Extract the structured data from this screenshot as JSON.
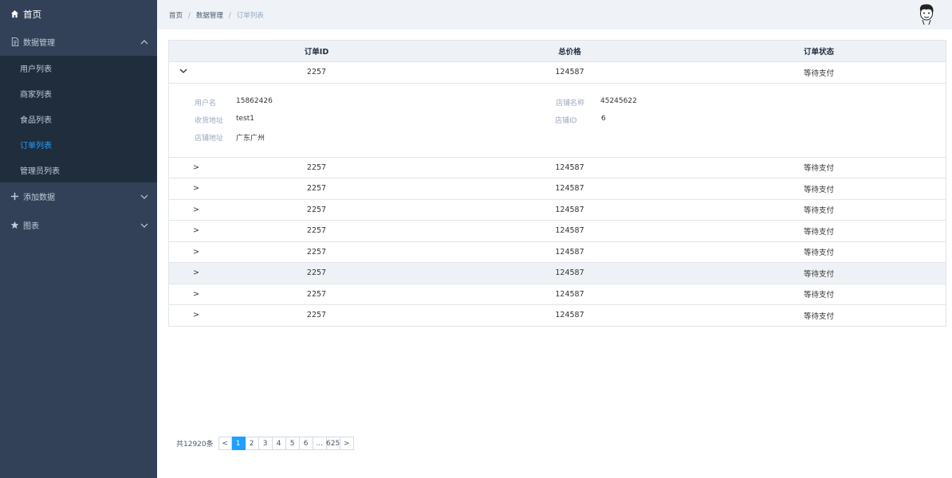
{
  "sidebar": {
    "home": "首页",
    "data_manage": "数据管理",
    "sub_items": [
      "用户列表",
      "商家列表",
      "食品列表",
      "订单列表",
      "管理员列表"
    ],
    "add_data": "添加数据",
    "charts": "图表",
    "active_index": 3
  },
  "breadcrumb": {
    "home": "首页",
    "sep1": "/",
    "section": "数据管理",
    "sep2": "/",
    "current": "订单列表"
  },
  "table": {
    "headers": [
      "订单ID",
      "总价格",
      "订单状态"
    ],
    "expanded_row": {
      "id": "2257",
      "price": "124587",
      "status": "等待支付"
    },
    "detail": {
      "username_label": "用户名",
      "username": "15862426",
      "address_label": "收货地址",
      "address": "test1",
      "shop_addr_label": "店铺地址",
      "shop_addr": "广东广州",
      "shop_name_label": "店铺名称",
      "shop_name": "45245622",
      "shop_id_label": "店铺ID",
      "shop_id": "6"
    },
    "rows": [
      {
        "expander": ">",
        "id": "2257",
        "price": "124587",
        "status": "等待支付"
      },
      {
        "expander": ">",
        "id": "2257",
        "price": "124587",
        "status": "等待支付"
      },
      {
        "expander": ">",
        "id": "2257",
        "price": "124587",
        "status": "等待支付"
      },
      {
        "expander": ">",
        "id": "2257",
        "price": "124587",
        "status": "等待支付"
      },
      {
        "expander": ">",
        "id": "2257",
        "price": "124587",
        "status": "等待支付"
      },
      {
        "expander": ">",
        "id": "2257",
        "price": "124587",
        "status": "等待支付"
      },
      {
        "expander": ">",
        "id": "2257",
        "price": "124587",
        "status": "等待支付"
      },
      {
        "expander": ">",
        "id": "2257",
        "price": "124587",
        "status": "等待支付"
      }
    ]
  },
  "pagination": {
    "total": "共12920条",
    "prev": "<",
    "next": ">",
    "pages": [
      "1",
      "2",
      "3",
      "4",
      "5",
      "6",
      "...",
      "625"
    ],
    "current": "1"
  },
  "colors": {
    "sidebar_bg": "#324157",
    "submenu_bg": "#1f2d3d",
    "accent": "#20a0ff",
    "header_bg": "#eff2f7"
  },
  "icons": {
    "home": "home-icon",
    "data": "document-icon",
    "add": "plus-icon",
    "charts": "star-icon",
    "avatar": "avatar-icon"
  }
}
